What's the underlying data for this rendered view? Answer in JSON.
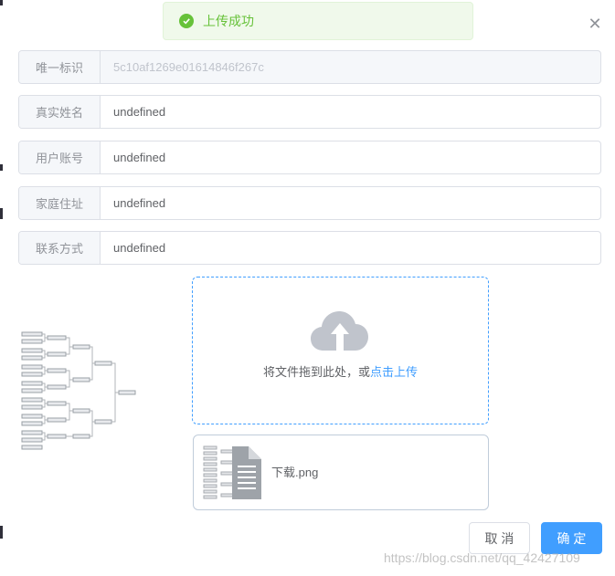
{
  "toast": {
    "message": "上传成功",
    "icon": "success-check-icon"
  },
  "dialog": {
    "close_icon": "close-icon"
  },
  "form": {
    "fields": [
      {
        "label": "唯一标识",
        "value": "5c10af1269e01614846f267c",
        "disabled": true
      },
      {
        "label": "真实姓名",
        "value": "undefined"
      },
      {
        "label": "用户账号",
        "value": "undefined"
      },
      {
        "label": "家庭住址",
        "value": "undefined"
      },
      {
        "label": "联系方式",
        "value": "undefined"
      }
    ]
  },
  "upload": {
    "icon": "cloud-upload-icon",
    "drag_text": "将文件拖到此处，或",
    "click_text": "点击上传",
    "files": [
      {
        "name": "下载.png"
      }
    ]
  },
  "buttons": {
    "cancel": "取 消",
    "confirm": "确 定"
  },
  "watermark": "https://blog.csdn.net/qq_42427109",
  "colors": {
    "primary": "#409eff",
    "success": "#67c23a"
  }
}
